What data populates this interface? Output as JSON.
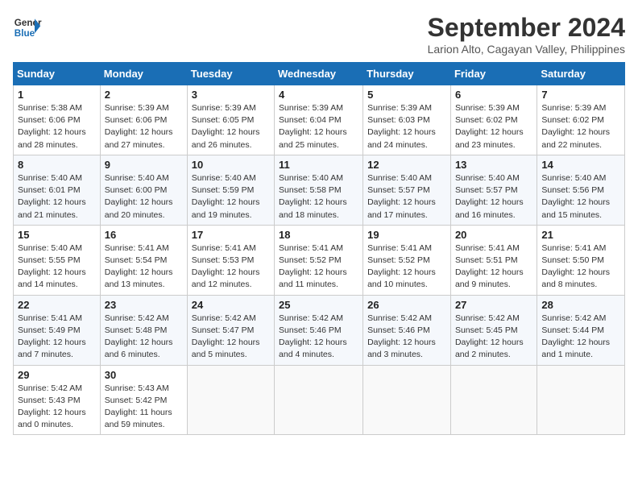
{
  "header": {
    "logo_line1": "General",
    "logo_line2": "Blue",
    "month": "September 2024",
    "location": "Larion Alto, Cagayan Valley, Philippines"
  },
  "weekdays": [
    "Sunday",
    "Monday",
    "Tuesday",
    "Wednesday",
    "Thursday",
    "Friday",
    "Saturday"
  ],
  "weeks": [
    [
      {
        "day": "1",
        "lines": [
          "Sunrise: 5:38 AM",
          "Sunset: 6:06 PM",
          "Daylight: 12 hours",
          "and 28 minutes."
        ]
      },
      {
        "day": "2",
        "lines": [
          "Sunrise: 5:39 AM",
          "Sunset: 6:06 PM",
          "Daylight: 12 hours",
          "and 27 minutes."
        ]
      },
      {
        "day": "3",
        "lines": [
          "Sunrise: 5:39 AM",
          "Sunset: 6:05 PM",
          "Daylight: 12 hours",
          "and 26 minutes."
        ]
      },
      {
        "day": "4",
        "lines": [
          "Sunrise: 5:39 AM",
          "Sunset: 6:04 PM",
          "Daylight: 12 hours",
          "and 25 minutes."
        ]
      },
      {
        "day": "5",
        "lines": [
          "Sunrise: 5:39 AM",
          "Sunset: 6:03 PM",
          "Daylight: 12 hours",
          "and 24 minutes."
        ]
      },
      {
        "day": "6",
        "lines": [
          "Sunrise: 5:39 AM",
          "Sunset: 6:02 PM",
          "Daylight: 12 hours",
          "and 23 minutes."
        ]
      },
      {
        "day": "7",
        "lines": [
          "Sunrise: 5:39 AM",
          "Sunset: 6:02 PM",
          "Daylight: 12 hours",
          "and 22 minutes."
        ]
      }
    ],
    [
      {
        "day": "8",
        "lines": [
          "Sunrise: 5:40 AM",
          "Sunset: 6:01 PM",
          "Daylight: 12 hours",
          "and 21 minutes."
        ]
      },
      {
        "day": "9",
        "lines": [
          "Sunrise: 5:40 AM",
          "Sunset: 6:00 PM",
          "Daylight: 12 hours",
          "and 20 minutes."
        ]
      },
      {
        "day": "10",
        "lines": [
          "Sunrise: 5:40 AM",
          "Sunset: 5:59 PM",
          "Daylight: 12 hours",
          "and 19 minutes."
        ]
      },
      {
        "day": "11",
        "lines": [
          "Sunrise: 5:40 AM",
          "Sunset: 5:58 PM",
          "Daylight: 12 hours",
          "and 18 minutes."
        ]
      },
      {
        "day": "12",
        "lines": [
          "Sunrise: 5:40 AM",
          "Sunset: 5:57 PM",
          "Daylight: 12 hours",
          "and 17 minutes."
        ]
      },
      {
        "day": "13",
        "lines": [
          "Sunrise: 5:40 AM",
          "Sunset: 5:57 PM",
          "Daylight: 12 hours",
          "and 16 minutes."
        ]
      },
      {
        "day": "14",
        "lines": [
          "Sunrise: 5:40 AM",
          "Sunset: 5:56 PM",
          "Daylight: 12 hours",
          "and 15 minutes."
        ]
      }
    ],
    [
      {
        "day": "15",
        "lines": [
          "Sunrise: 5:40 AM",
          "Sunset: 5:55 PM",
          "Daylight: 12 hours",
          "and 14 minutes."
        ]
      },
      {
        "day": "16",
        "lines": [
          "Sunrise: 5:41 AM",
          "Sunset: 5:54 PM",
          "Daylight: 12 hours",
          "and 13 minutes."
        ]
      },
      {
        "day": "17",
        "lines": [
          "Sunrise: 5:41 AM",
          "Sunset: 5:53 PM",
          "Daylight: 12 hours",
          "and 12 minutes."
        ]
      },
      {
        "day": "18",
        "lines": [
          "Sunrise: 5:41 AM",
          "Sunset: 5:52 PM",
          "Daylight: 12 hours",
          "and 11 minutes."
        ]
      },
      {
        "day": "19",
        "lines": [
          "Sunrise: 5:41 AM",
          "Sunset: 5:52 PM",
          "Daylight: 12 hours",
          "and 10 minutes."
        ]
      },
      {
        "day": "20",
        "lines": [
          "Sunrise: 5:41 AM",
          "Sunset: 5:51 PM",
          "Daylight: 12 hours",
          "and 9 minutes."
        ]
      },
      {
        "day": "21",
        "lines": [
          "Sunrise: 5:41 AM",
          "Sunset: 5:50 PM",
          "Daylight: 12 hours",
          "and 8 minutes."
        ]
      }
    ],
    [
      {
        "day": "22",
        "lines": [
          "Sunrise: 5:41 AM",
          "Sunset: 5:49 PM",
          "Daylight: 12 hours",
          "and 7 minutes."
        ]
      },
      {
        "day": "23",
        "lines": [
          "Sunrise: 5:42 AM",
          "Sunset: 5:48 PM",
          "Daylight: 12 hours",
          "and 6 minutes."
        ]
      },
      {
        "day": "24",
        "lines": [
          "Sunrise: 5:42 AM",
          "Sunset: 5:47 PM",
          "Daylight: 12 hours",
          "and 5 minutes."
        ]
      },
      {
        "day": "25",
        "lines": [
          "Sunrise: 5:42 AM",
          "Sunset: 5:46 PM",
          "Daylight: 12 hours",
          "and 4 minutes."
        ]
      },
      {
        "day": "26",
        "lines": [
          "Sunrise: 5:42 AM",
          "Sunset: 5:46 PM",
          "Daylight: 12 hours",
          "and 3 minutes."
        ]
      },
      {
        "day": "27",
        "lines": [
          "Sunrise: 5:42 AM",
          "Sunset: 5:45 PM",
          "Daylight: 12 hours",
          "and 2 minutes."
        ]
      },
      {
        "day": "28",
        "lines": [
          "Sunrise: 5:42 AM",
          "Sunset: 5:44 PM",
          "Daylight: 12 hours",
          "and 1 minute."
        ]
      }
    ],
    [
      {
        "day": "29",
        "lines": [
          "Sunrise: 5:42 AM",
          "Sunset: 5:43 PM",
          "Daylight: 12 hours",
          "and 0 minutes."
        ]
      },
      {
        "day": "30",
        "lines": [
          "Sunrise: 5:43 AM",
          "Sunset: 5:42 PM",
          "Daylight: 11 hours",
          "and 59 minutes."
        ]
      },
      {
        "day": "",
        "lines": []
      },
      {
        "day": "",
        "lines": []
      },
      {
        "day": "",
        "lines": []
      },
      {
        "day": "",
        "lines": []
      },
      {
        "day": "",
        "lines": []
      }
    ]
  ]
}
